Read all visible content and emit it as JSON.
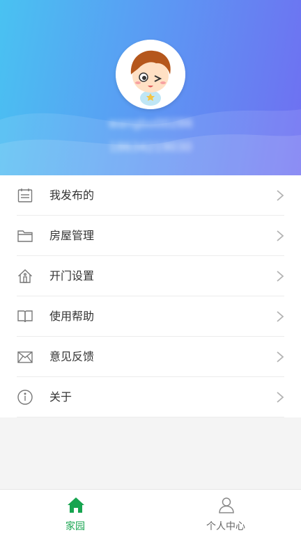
{
  "profile": {
    "username": "wangbo00286",
    "phone": "18634219030"
  },
  "menu": {
    "items": [
      {
        "label": "我发布的",
        "icon": "calendar-icon"
      },
      {
        "label": "房屋管理",
        "icon": "folder-icon"
      },
      {
        "label": "开门设置",
        "icon": "house-icon"
      },
      {
        "label": "使用帮助",
        "icon": "book-icon"
      },
      {
        "label": "意见反馈",
        "icon": "envelope-icon"
      },
      {
        "label": "关于",
        "icon": "info-icon"
      }
    ]
  },
  "tabbar": {
    "tabs": [
      {
        "label": "家园",
        "icon": "home-icon",
        "active": true
      },
      {
        "label": "个人中心",
        "icon": "user-icon",
        "active": false
      }
    ]
  },
  "colors": {
    "header_start": "#49c2f2",
    "header_end": "#6f6ff2",
    "active_tab": "#16a44f",
    "inactive_tab": "#666666"
  }
}
